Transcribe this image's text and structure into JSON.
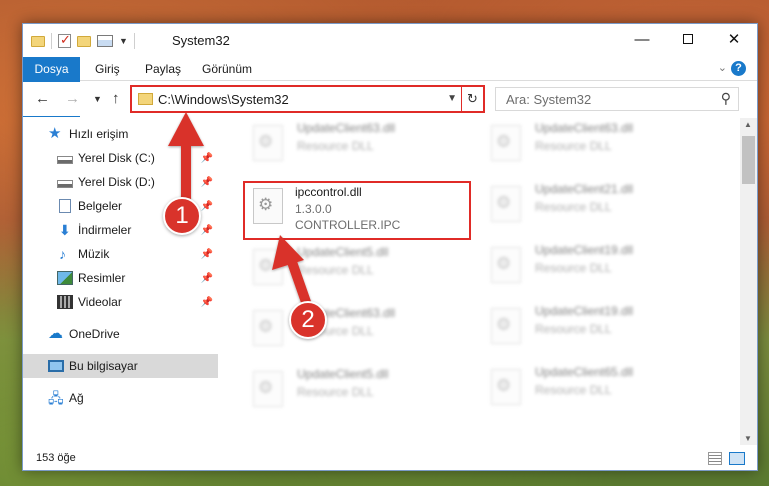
{
  "window": {
    "title": "System32",
    "minimize_label": "—",
    "maximize_icon": "maximize-icon",
    "close_label": "✕"
  },
  "ribbon": {
    "tabs": [
      "Dosya",
      "Giriş",
      "Paylaş",
      "Görünüm"
    ],
    "accent_color": "#1979ca",
    "help_label": "?"
  },
  "navigation": {
    "address_path": "C:\\Windows\\System32",
    "search_placeholder": "Ara: System32"
  },
  "sidebar": {
    "items": [
      {
        "label": "Hızlı erişim",
        "icon": "star-icon",
        "pinned": false
      },
      {
        "label": "Yerel Disk (C:)",
        "icon": "drive-icon",
        "pinned": true
      },
      {
        "label": "Yerel Disk (D:)",
        "icon": "drive-icon",
        "pinned": true
      },
      {
        "label": "Belgeler",
        "icon": "documents-icon",
        "pinned": true
      },
      {
        "label": "İndirmeler",
        "icon": "download-icon",
        "pinned": true
      },
      {
        "label": "Müzik",
        "icon": "music-icon",
        "pinned": true
      },
      {
        "label": "Resimler",
        "icon": "pictures-icon",
        "pinned": true
      },
      {
        "label": "Videolar",
        "icon": "videos-icon",
        "pinned": true
      },
      {
        "label": "OneDrive",
        "icon": "onedrive-icon",
        "pinned": false
      },
      {
        "label": "Bu bilgisayar",
        "icon": "this-pc-icon",
        "pinned": false,
        "selected": true
      },
      {
        "label": "Ağ",
        "icon": "network-icon",
        "pinned": false
      }
    ]
  },
  "files": {
    "left_column": [
      {
        "name": "UpdateClient63.dll",
        "type": "Resource DLL"
      },
      {
        "name": "ipccontrol.dll",
        "version": "1.3.0.0",
        "description": "CONTROLLER.IPC",
        "highlighted": true
      },
      {
        "name": "UpdateClient5.dll",
        "type": "Resource DLL"
      },
      {
        "name": "UpdateClient63.dll",
        "type": "Resource DLL"
      },
      {
        "name": "UpdateClient5.dll",
        "type": "Resource DLL"
      }
    ],
    "right_column": [
      {
        "name": "UpdateClient63.dll",
        "type": "Resource DLL"
      },
      {
        "name": "UpdateClient21.dll",
        "type": "Resource DLL"
      },
      {
        "name": "UpdateClient19.dll",
        "type": "Resource DLL"
      },
      {
        "name": "UpdateClient19.dll",
        "type": "Resource DLL"
      },
      {
        "name": "UpdateClient65.dll",
        "type": "Resource DLL"
      }
    ]
  },
  "status": {
    "item_count": "153 öğe"
  },
  "callouts": [
    {
      "number": "1",
      "color": "#d9332b"
    },
    {
      "number": "2",
      "color": "#d9332b"
    }
  ],
  "highlight_color": "#e02b27"
}
